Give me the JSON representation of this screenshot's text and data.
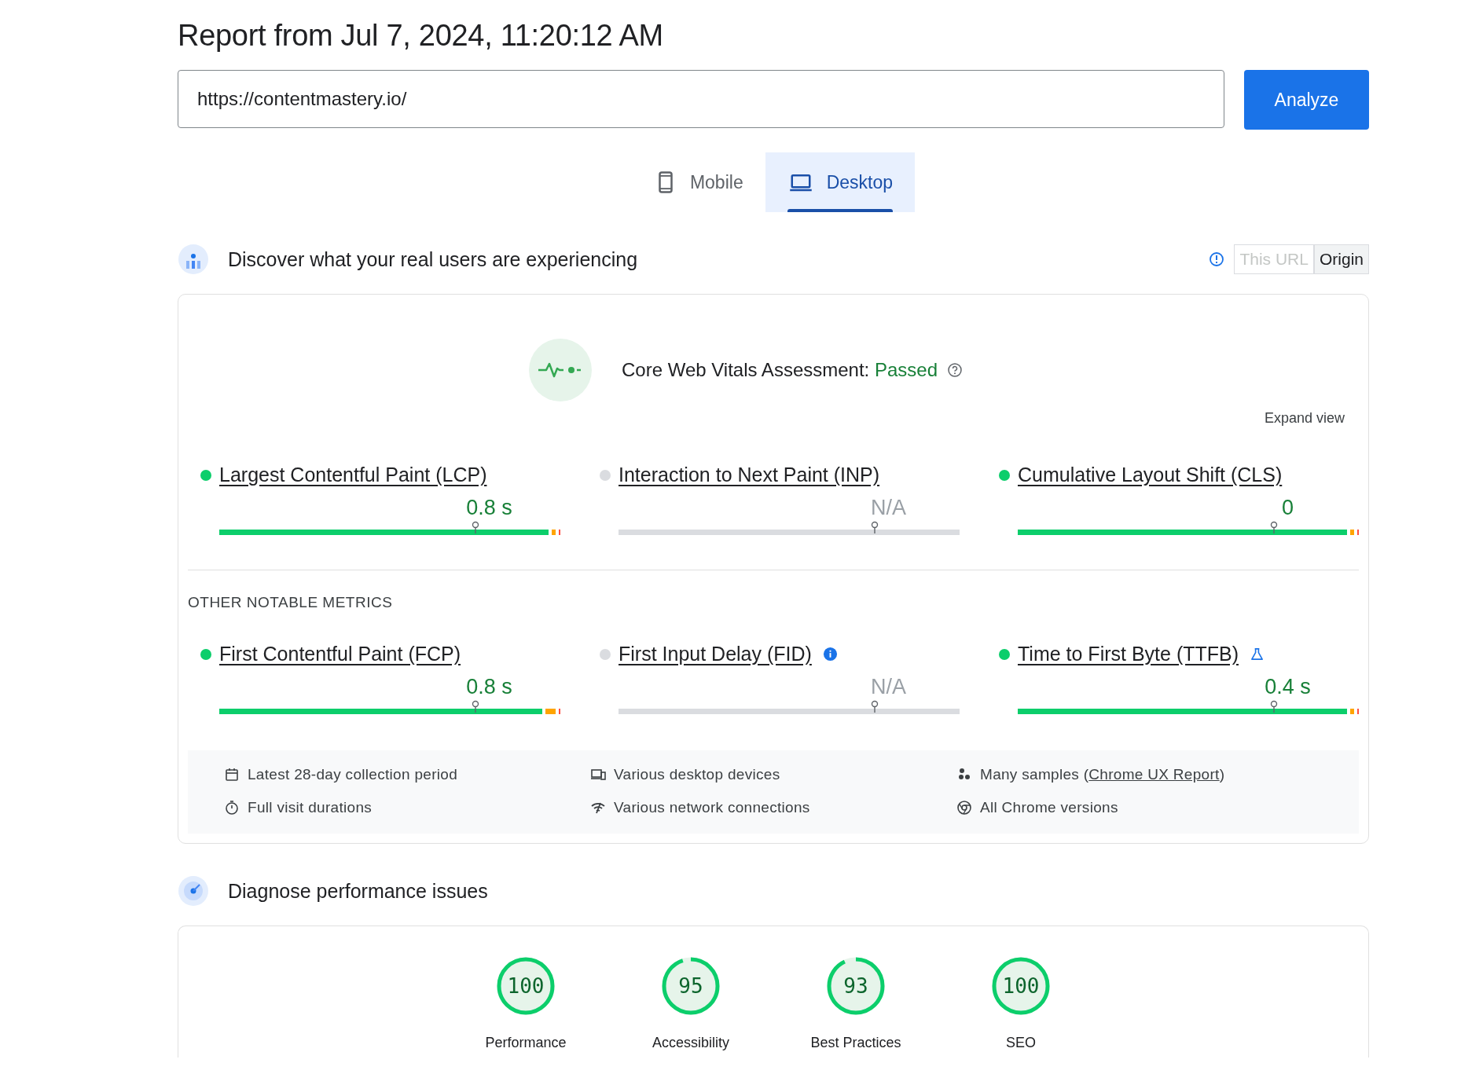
{
  "title": "Report from Jul 7, 2024, 11:20:12 AM",
  "url_field": {
    "value": "https://contentmastery.io/"
  },
  "analyze_button": "Analyze",
  "device_tabs": [
    {
      "label": "Mobile",
      "kind": "phone",
      "selected": false
    },
    {
      "label": "Desktop",
      "kind": "laptop",
      "selected": true
    }
  ],
  "field_section": {
    "heading": "Discover what your real users are experiencing",
    "scope_toggle": [
      {
        "label": "This URL",
        "disabled": true,
        "selected": false
      },
      {
        "label": "Origin",
        "disabled": false,
        "selected": true
      }
    ]
  },
  "assessment": {
    "label": "Core Web Vitals Assessment:",
    "result": "Passed",
    "expand": "Expand view"
  },
  "core_metrics": [
    {
      "name": "Largest Contentful Paint (LCP)",
      "value": "0.8 s",
      "good": true,
      "level": 0.75
    },
    {
      "name": "Interaction to Next Paint (INP)",
      "value": "N/A",
      "good": false,
      "level": 0.75
    },
    {
      "name": "Cumulative Layout Shift (CLS)",
      "value": "0",
      "good": true,
      "level": 0.75
    }
  ],
  "other_heading": "OTHER NOTABLE METRICS",
  "other_metrics": [
    {
      "name": "First Contentful Paint (FCP)",
      "value": "0.8 s",
      "good": true,
      "level": 0.75,
      "kind": "plain"
    },
    {
      "name": "First Input Delay (FID)",
      "value": "N/A",
      "good": false,
      "level": 0.75,
      "kind": "info"
    },
    {
      "name": "Time to First Byte (TTFB)",
      "value": "0.4 s",
      "good": true,
      "level": 0.75,
      "kind": "experimental"
    }
  ],
  "sources": [
    {
      "kind": "calendar",
      "text": "Latest 28-day collection period"
    },
    {
      "kind": "devices",
      "text": "Various desktop devices"
    },
    {
      "kind": "samples",
      "text": "Many samples (",
      "link": "Chrome UX Report",
      "suffix": ")"
    },
    {
      "kind": "timer",
      "text": "Full visit durations"
    },
    {
      "kind": "network",
      "text": "Various network connections"
    },
    {
      "kind": "chrome",
      "text": "All Chrome versions"
    }
  ],
  "diagnose_heading": "Diagnose performance issues",
  "scores": [
    {
      "score": "100",
      "label": "Performance",
      "level": 1.0
    },
    {
      "score": "95",
      "label": "Accessibility",
      "level": 0.95
    },
    {
      "score": "93",
      "label": "Best Practices",
      "level": 0.93
    },
    {
      "score": "100",
      "label": "SEO",
      "level": 1.0
    }
  ]
}
